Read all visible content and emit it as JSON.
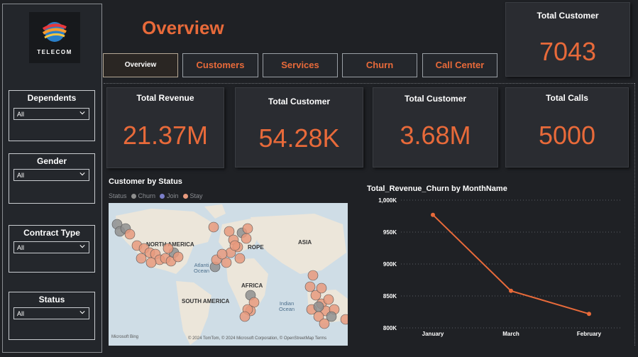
{
  "logo": {
    "text": "TELECOM"
  },
  "page_title": "Overview",
  "slicers": [
    {
      "title": "Dependents",
      "value": "All"
    },
    {
      "title": "Gender",
      "value": "All"
    },
    {
      "title": "Contract Type",
      "value": "All"
    },
    {
      "title": "Status",
      "value": "All"
    }
  ],
  "nav": [
    {
      "label": "Overview",
      "active": true
    },
    {
      "label": "Customers"
    },
    {
      "label": "Services"
    },
    {
      "label": "Churn"
    },
    {
      "label": "Call Center"
    }
  ],
  "cards": {
    "top_right": {
      "title": "Total Customer",
      "value": "7043"
    },
    "revenue": {
      "title": "Total Revenue",
      "value": "21.37M"
    },
    "customer_k": {
      "title": "Total Customer",
      "value": "54.28K"
    },
    "customer_m": {
      "title": "Total Customer",
      "value": "3.68M"
    },
    "calls": {
      "title": "Total Calls",
      "value": "5000"
    }
  },
  "map": {
    "title": "Customer by Status",
    "legend_label": "Status",
    "legend": [
      {
        "name": "Churn",
        "color": "#8f8f8f"
      },
      {
        "name": "Join",
        "color": "#7b7fc9"
      },
      {
        "name": "Stay",
        "color": "#e89a7e"
      }
    ],
    "regions": {
      "north_america": "NORTH AMERICA",
      "europe": "ROPE",
      "asia": "ASIA",
      "africa": "AFRICA",
      "south_america": "SOUTH AMERICA"
    },
    "oceans": {
      "atlantic": "Atlanti\nOcean",
      "indian": "Indian\nOcean"
    },
    "bing": "Microsoft Bing",
    "attribution": "© 2024 TomTom, © 2024 Microsoft Corporation, © OpenStreetMap  Terms"
  },
  "chart_data": {
    "type": "line",
    "title": "Total_Revenue_Churn by MonthName",
    "categories": [
      "January",
      "March",
      "February"
    ],
    "series": [
      {
        "values": [
          977000,
          858000,
          822000
        ]
      }
    ],
    "ylim": [
      800000,
      1000000
    ],
    "yticks": [
      1000000,
      950000,
      900000,
      850000,
      800000
    ],
    "ytick_labels": [
      "1,000K",
      "950K",
      "900K",
      "850K",
      "800K"
    ],
    "grid": true,
    "line_color": "#e86a3a"
  }
}
